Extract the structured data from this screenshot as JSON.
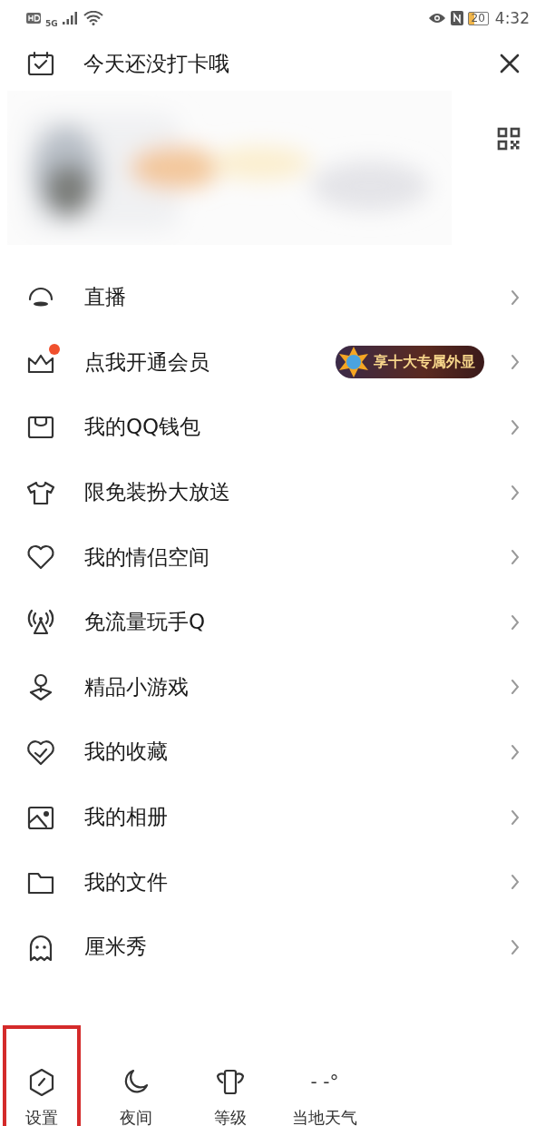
{
  "status_bar": {
    "network": "5G",
    "battery": "20",
    "time": "4:32"
  },
  "header": {
    "title": "今天还没打卡哦"
  },
  "menu": [
    {
      "label": "直播",
      "dot": false
    },
    {
      "label": "点我开通会员",
      "dot": true,
      "promo": "享十大专属外显"
    },
    {
      "label": "我的QQ钱包",
      "dot": false
    },
    {
      "label": "限免装扮大放送",
      "dot": false
    },
    {
      "label": "我的情侣空间",
      "dot": false
    },
    {
      "label": "免流量玩手Q",
      "dot": false
    },
    {
      "label": "精品小游戏",
      "dot": false
    },
    {
      "label": "我的收藏",
      "dot": false
    },
    {
      "label": "我的相册",
      "dot": false
    },
    {
      "label": "我的文件",
      "dot": false
    },
    {
      "label": "厘米秀",
      "dot": false
    }
  ],
  "bottom_bar": [
    {
      "label": "设置",
      "highlighted": true
    },
    {
      "label": "夜间",
      "highlighted": false
    },
    {
      "label": "等级",
      "highlighted": false
    },
    {
      "label": "当地天气",
      "reading": "- -°",
      "highlighted": false
    }
  ]
}
